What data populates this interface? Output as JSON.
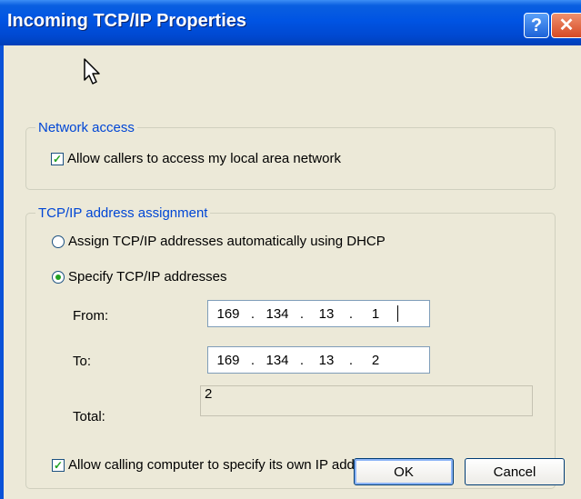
{
  "window": {
    "title": "Incoming TCP/IP Properties"
  },
  "titlebar": {
    "help_glyph": "?",
    "close_glyph": "✕"
  },
  "network_access": {
    "legend": "Network access",
    "allow_lan_label": "Allow callers to access my local area network",
    "allow_lan_checked": true
  },
  "tcpip": {
    "legend": "TCP/IP address assignment",
    "dhcp_label": "Assign TCP/IP addresses automatically using DHCP",
    "dhcp_selected": false,
    "specify_label": "Specify TCP/IP addresses",
    "specify_selected": true,
    "from_label": "From:",
    "from_ip": [
      "169",
      "134",
      "13",
      "1"
    ],
    "to_label": "To:",
    "to_ip": [
      "169",
      "134",
      "13",
      "2"
    ],
    "total_label": "Total:",
    "total_value": "2",
    "allow_own_ip_label": "Allow calling computer to specify its own IP address",
    "allow_own_ip_checked": true
  },
  "buttons": {
    "ok": "OK",
    "cancel": "Cancel"
  },
  "colors": {
    "titlebar": "#0054e3",
    "legend": "#0046d5",
    "check_mark": "#21a121",
    "dialog_bg": "#ece9d8"
  },
  "icons": {
    "help": "help-icon",
    "close": "close-icon",
    "cursor": "mouse-cursor-icon"
  }
}
